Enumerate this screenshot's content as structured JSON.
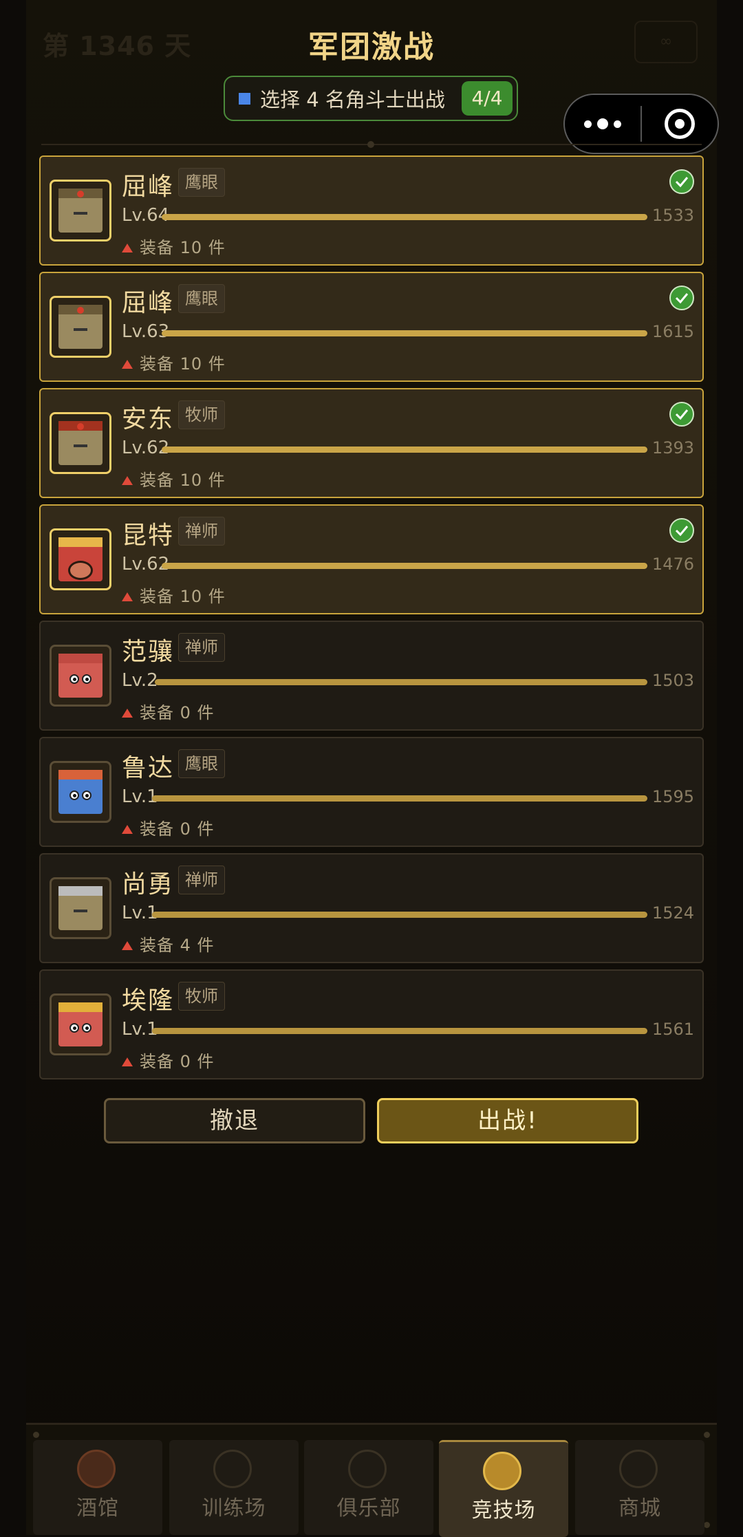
{
  "page": {
    "title": "军团激战",
    "background_day": "第 1346 天",
    "background_button": "∞"
  },
  "hint": {
    "text": "选择 4 名角斗士出战",
    "count": "4/4",
    "marker_color": "#4a86e8"
  },
  "capsule": {
    "more_icon": "more-dots-icon",
    "close_icon": "target-close-icon"
  },
  "colors": {
    "accent": "#f1d488",
    "selected_border": "#c9a43c",
    "check": "#3d9a34",
    "fight": "#6b5516"
  },
  "roster": [
    {
      "name": "屈峰",
      "class": "鹰眼",
      "level": "Lv.64",
      "power": "1533",
      "equip": "装备 10 件",
      "selected": true
    },
    {
      "name": "屈峰",
      "class": "鹰眼",
      "level": "Lv.63",
      "power": "1615",
      "equip": "装备 10 件",
      "selected": true
    },
    {
      "name": "安东",
      "class": "牧师",
      "level": "Lv.62",
      "power": "1393",
      "equip": "装备 10 件",
      "selected": true
    },
    {
      "name": "昆特",
      "class": "禅师",
      "level": "Lv.62",
      "power": "1476",
      "equip": "装备 10 件",
      "selected": true
    },
    {
      "name": "范骧",
      "class": "禅师",
      "level": "Lv.2",
      "power": "1503",
      "equip": "装备 0 件",
      "selected": false
    },
    {
      "name": "鲁达",
      "class": "鹰眼",
      "level": "Lv.1",
      "power": "1595",
      "equip": "装备 0 件",
      "selected": false
    },
    {
      "name": "尚勇",
      "class": "禅师",
      "level": "Lv.1",
      "power": "1524",
      "equip": "装备 4 件",
      "selected": false
    },
    {
      "name": "埃隆",
      "class": "牧师",
      "level": "Lv.1",
      "power": "1561",
      "equip": "装备 0 件",
      "selected": false
    }
  ],
  "actions": {
    "retreat": "撤退",
    "fight": "出战!"
  },
  "nav": [
    {
      "label": "酒馆",
      "icon": "tavern-icon"
    },
    {
      "label": "训练场",
      "icon": "training-icon"
    },
    {
      "label": "俱乐部",
      "icon": "club-icon"
    },
    {
      "label": "竞技场",
      "icon": "arena-icon",
      "active": true
    },
    {
      "label": "商城",
      "icon": "shop-icon"
    }
  ]
}
